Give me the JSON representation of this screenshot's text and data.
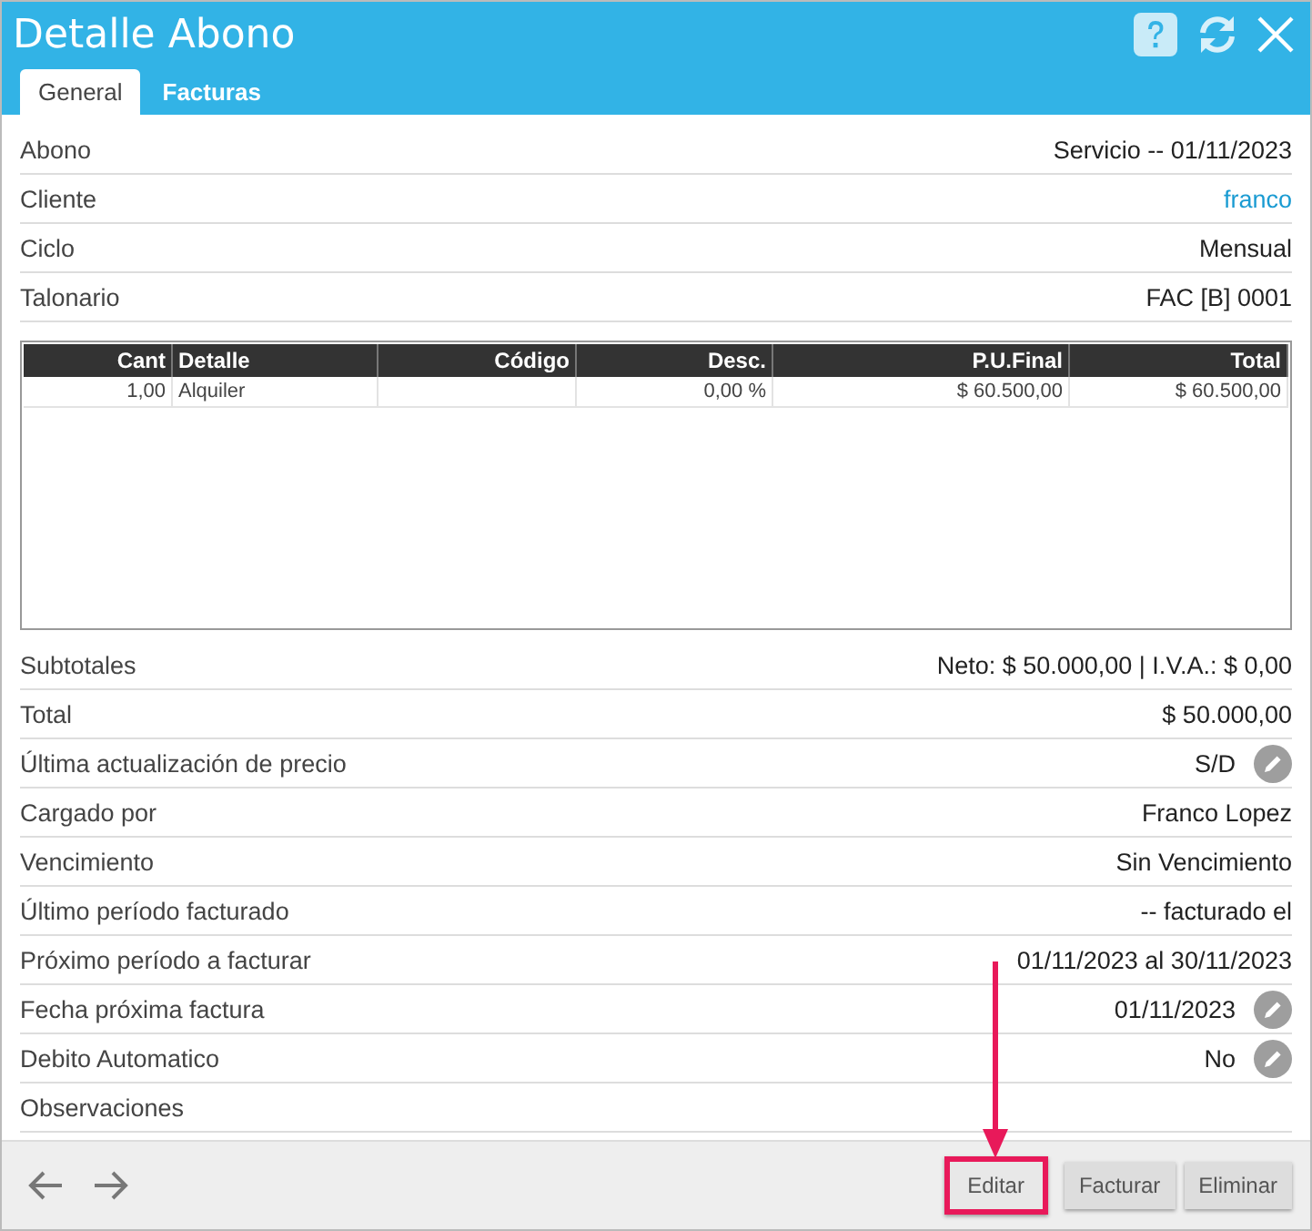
{
  "window": {
    "title": "Detalle Abono"
  },
  "tabs": [
    {
      "label": "General",
      "selected": true
    },
    {
      "label": "Facturas",
      "selected": false
    }
  ],
  "fields": [
    {
      "label": "Abono",
      "value": "Servicio -- 01/11/2023",
      "link": false,
      "editable": false
    },
    {
      "label": "Cliente",
      "value": "franco",
      "link": true,
      "editable": false
    },
    {
      "label": "Ciclo",
      "value": "Mensual",
      "link": false,
      "editable": false
    },
    {
      "label": "Talonario",
      "value": "FAC [B] 0001",
      "link": false,
      "editable": false
    }
  ],
  "table": {
    "columns": [
      "Cant",
      "Detalle",
      "Código",
      "Desc.",
      "P.U.Final",
      "Total"
    ],
    "rows": [
      [
        "1,00",
        "Alquiler",
        "",
        "0,00 %",
        "$ 60.500,00",
        "$ 60.500,00"
      ]
    ]
  },
  "details": [
    {
      "label": "Subtotales",
      "value": "Neto: $ 50.000,00 | I.V.A.: $ 0,00",
      "editable": false
    },
    {
      "label": "Total",
      "value": "$ 50.000,00",
      "editable": false
    },
    {
      "label": "Última actualización de precio",
      "value": "S/D",
      "editable": true
    },
    {
      "label": "Cargado por",
      "value": "Franco Lopez",
      "editable": false
    },
    {
      "label": "Vencimiento",
      "value": "Sin Vencimiento",
      "editable": false
    },
    {
      "label": "Último período facturado",
      "value": "-- facturado el",
      "editable": false
    },
    {
      "label": "Próximo período a facturar",
      "value": "01/11/2023 al 30/11/2023",
      "editable": false
    },
    {
      "label": "Fecha próxima factura",
      "value": "01/11/2023",
      "editable": true
    },
    {
      "label": "Debito Automatico",
      "value": "No",
      "editable": true
    },
    {
      "label": "Observaciones",
      "editable": false
    }
  ],
  "buttons": [
    {
      "label": "Editar",
      "highlighted": true
    },
    {
      "label": "Facturar",
      "highlighted": false
    },
    {
      "label": "Eliminar",
      "highlighted": false
    }
  ]
}
